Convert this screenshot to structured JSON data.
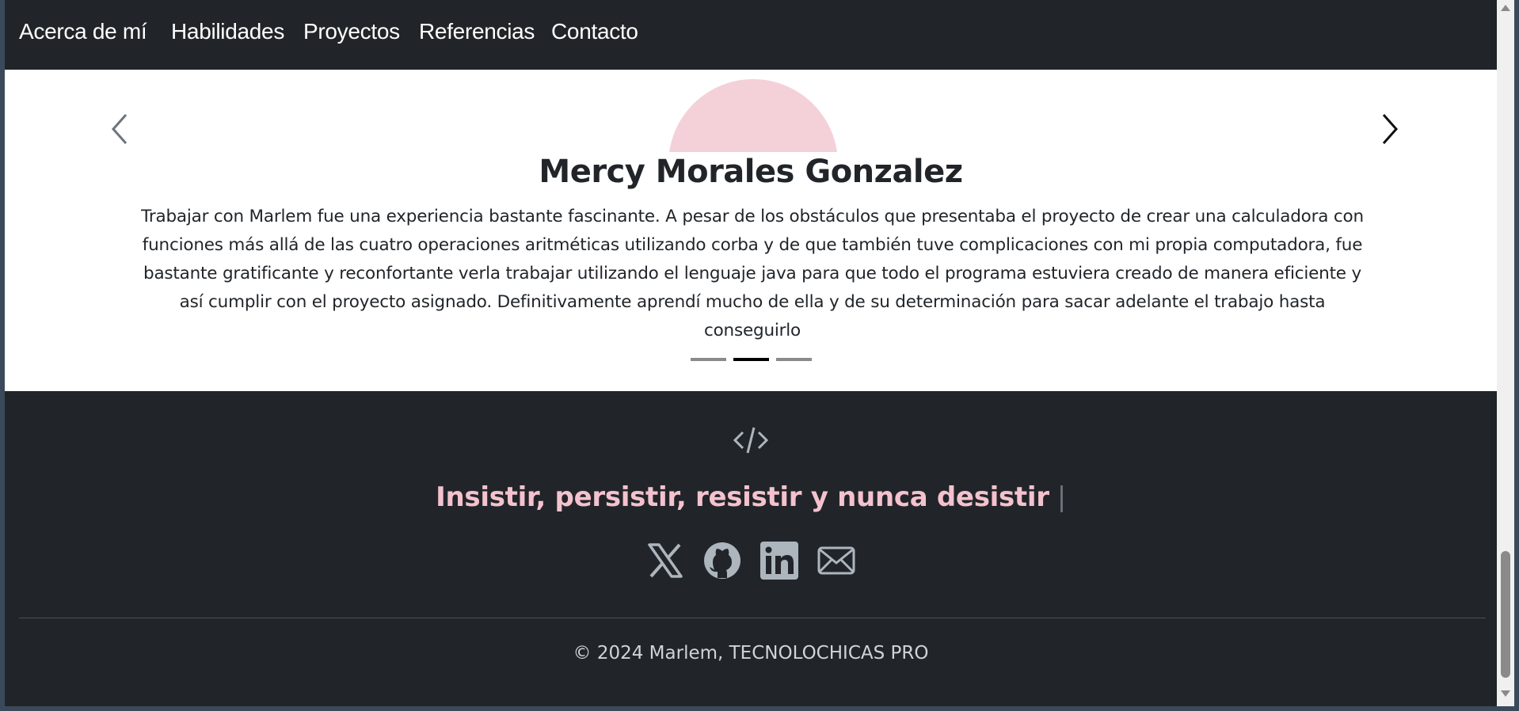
{
  "nav": {
    "about": "Acerca de mí",
    "skills": "Habilidades",
    "projects": "Proyectos",
    "references": "Referencias",
    "contact": "Contacto"
  },
  "carousel": {
    "name": "Mercy Morales Gonzalez",
    "text": "Trabajar con Marlem fue una experiencia bastante fascinante. A pesar de los obstáculos que presentaba el proyecto de crear una calculadora con funciones más allá de las cuatro operaciones aritméticas utilizando corba y de que también tuve complicaciones con mi propia computadora, fue bastante gratificante y reconfortante verla trabajar utilizando el lenguaje java para que todo el programa estuviera creado de manera eficiente y así cumplir con el proyecto asignado. Definitivamente aprendí mucho de ella y de su determinación para sacar adelante el trabajo hasta conseguirlo",
    "slide_count": 3,
    "active_slide": 2,
    "avatar_color": "#f4d1d9"
  },
  "footer": {
    "icon": "code-slash-icon",
    "motto": "Insistir, persistir, resistir y nunca desistir",
    "cursor": "|",
    "motto_color": "#f4c2ce",
    "social": [
      "x-twitter-icon",
      "github-icon",
      "linkedin-icon",
      "envelope-icon"
    ],
    "copyright": "© 2024 Marlem, TECNOLOCHICAS PRO"
  },
  "colors": {
    "dark_bg": "#212529",
    "icon_gray": "#adb5bd"
  }
}
